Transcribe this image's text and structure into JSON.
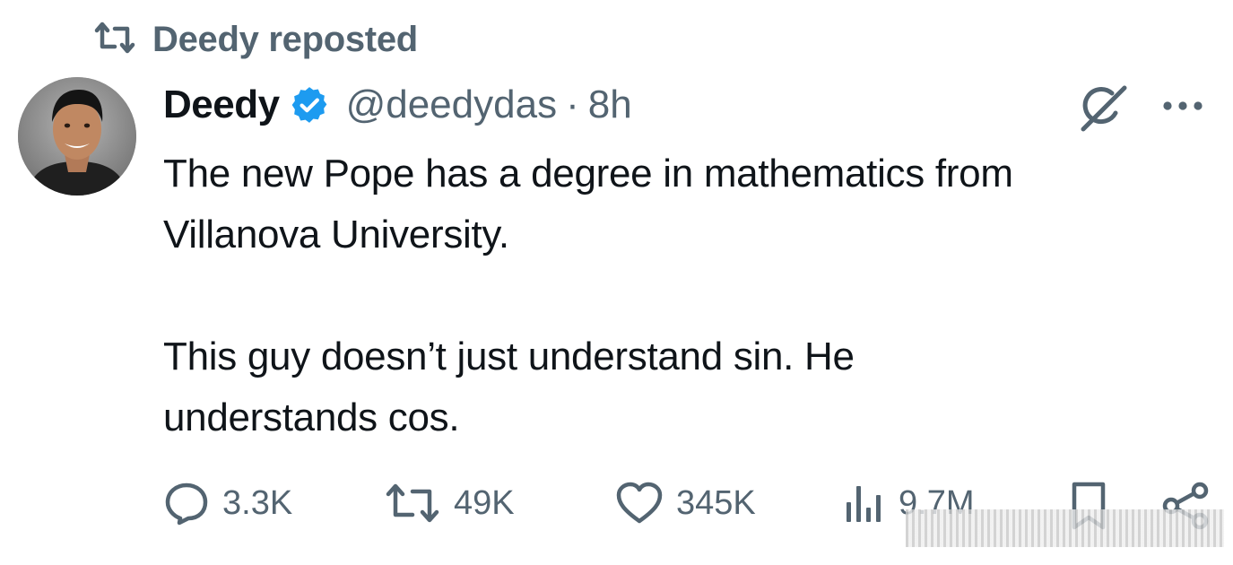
{
  "repost": {
    "label": "Deedy reposted"
  },
  "author": {
    "display_name": "Deedy",
    "handle": "@deedydas",
    "separator": "·",
    "time": "8h"
  },
  "tweet": {
    "text": "The new Pope has a degree in mathematics from\nVillanova University.\n\nThis guy doesn’t just understand sin. He\nunderstands cos."
  },
  "actions": {
    "replies": "3.3K",
    "reposts": "49K",
    "likes": "345K",
    "views": "9.7M"
  },
  "icons": {
    "repost_header": "repost-icon",
    "verified": "verified-badge-icon",
    "grok": "grok-icon",
    "more": "more-icon",
    "reply": "reply-icon",
    "repost": "repost-icon",
    "like": "heart-icon",
    "views": "views-icon",
    "bookmark": "bookmark-icon",
    "share": "share-icon"
  },
  "colors": {
    "text": "#0f1419",
    "secondary": "#536471",
    "verified": "#1d9bf0"
  }
}
